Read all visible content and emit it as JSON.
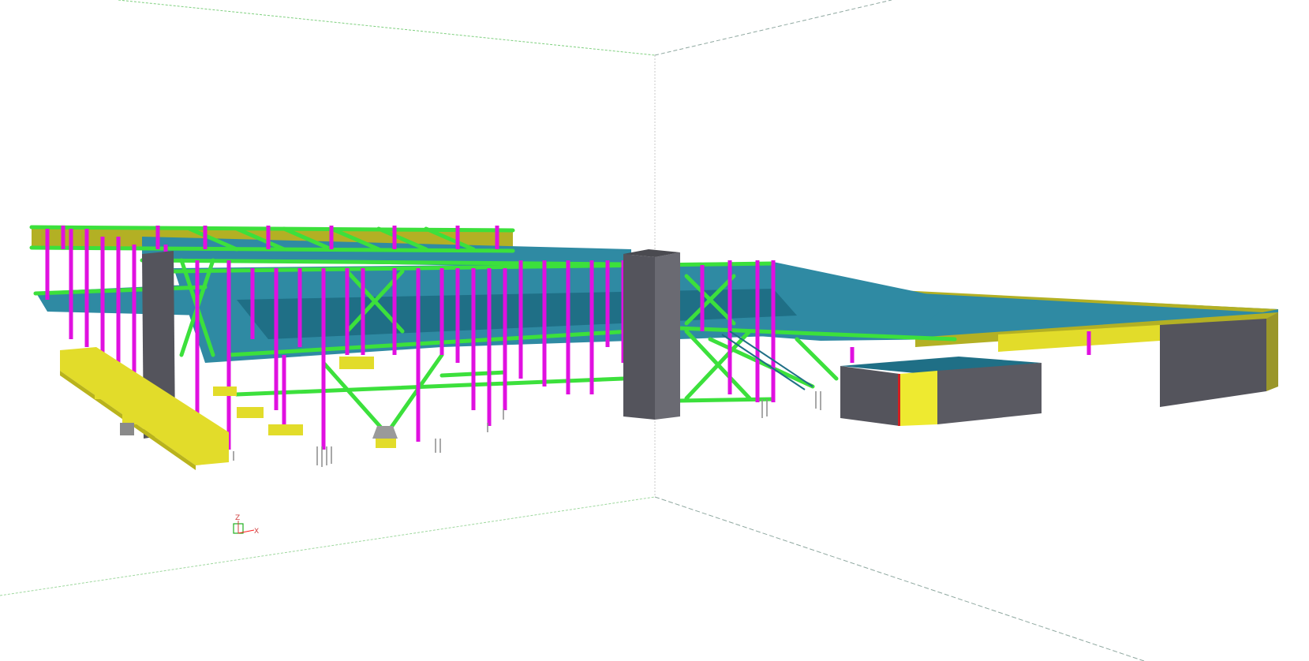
{
  "viewport": {
    "background": "#ffffff",
    "view_type": "3D isometric structural model"
  },
  "colors": {
    "steel_column": "#e010e0",
    "steel_beam": "#3ce03c",
    "deck": "#2f8aa3",
    "deck_dark": "#1f6f86",
    "concrete_yellow": "#e2dc2a",
    "concrete_yellow_dark": "#b9b31c",
    "roof_olive": "#b3b024",
    "core_gray": "#54545c",
    "core_gray_light": "#6a6a72",
    "pile_gray": "#9a9a9a",
    "bounding_line": "#7fd07f",
    "bounding_dashed": "#8fa8a0"
  },
  "axis_gizmo": {
    "z_label": "Z",
    "x_label": "X",
    "x_color": "#ff2020",
    "z_color": "#d04040",
    "box_color": "#20b020"
  }
}
